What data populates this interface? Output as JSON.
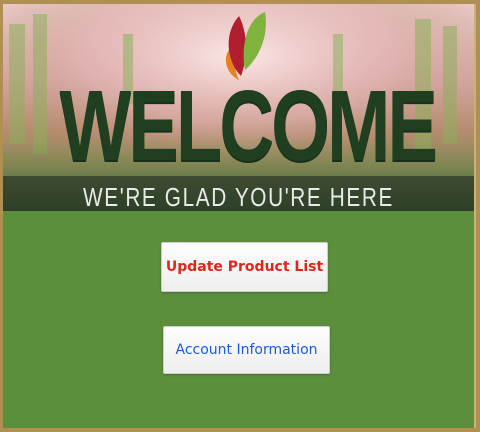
{
  "banner": {
    "title": "WELCOME",
    "subtitle": "WE'RE GLAD YOU'RE HERE",
    "logo_icon": "flame-leaf-logo"
  },
  "buttons": {
    "update_product_list": {
      "label": "Update Product List",
      "color": "#e0261b"
    },
    "account_information": {
      "label": "Account Information",
      "color": "#1e5ad8"
    }
  },
  "colors": {
    "background": "#5b8f3c",
    "frame": "#b08f52"
  }
}
